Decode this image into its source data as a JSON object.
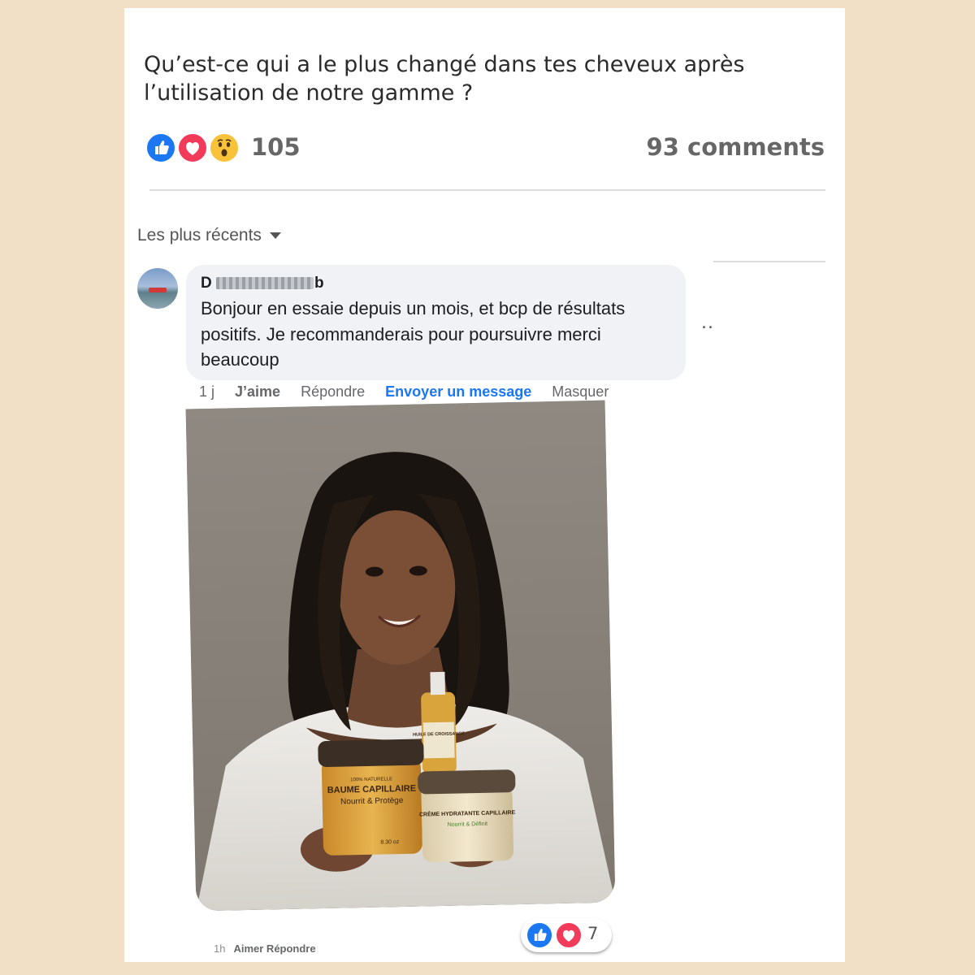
{
  "post": {
    "question": "Qu’est-ce qui a le plus changé dans tes cheveux  après l’utilisation de notre gamme ?",
    "reactions_count": "105",
    "reaction_icons": [
      "like-icon",
      "love-icon",
      "wow-icon"
    ],
    "comments_count": "93 comments"
  },
  "sort": {
    "label": "Les plus récents"
  },
  "comment": {
    "author_visible": "D",
    "author_tail": "b",
    "text": "Bonjour en essaie depuis un mois, et bcp de résultats positifs. Je recommanderais pour poursuivre merci beaucoup",
    "more": "..",
    "actions": {
      "time": "1 j",
      "like": "J’aime",
      "reply": "Répondre",
      "message": "Envoyer un message",
      "hide": "Masquer"
    },
    "photo_products": {
      "jar1_small": "100% NATURELLE",
      "jar1_title": "BAUME CAPILLAIRE",
      "jar1_sub": "Nourrit & Protège",
      "jar1_weight": "8.30 oz",
      "oil_label": "HUILE DE CROISSANCE",
      "jar2_title": "CRÈME HYDRATANTE CAPILLAIRE",
      "jar2_sub": "Nourrit & Définit"
    }
  },
  "footer": {
    "time": "1h",
    "actions": "Aimer Répondre",
    "reaction_count": "7"
  },
  "colors": {
    "background": "#f1dfc6",
    "like_blue": "#1b77f2",
    "love_red": "#f23a5a",
    "wow_yellow": "#f8c23b"
  }
}
